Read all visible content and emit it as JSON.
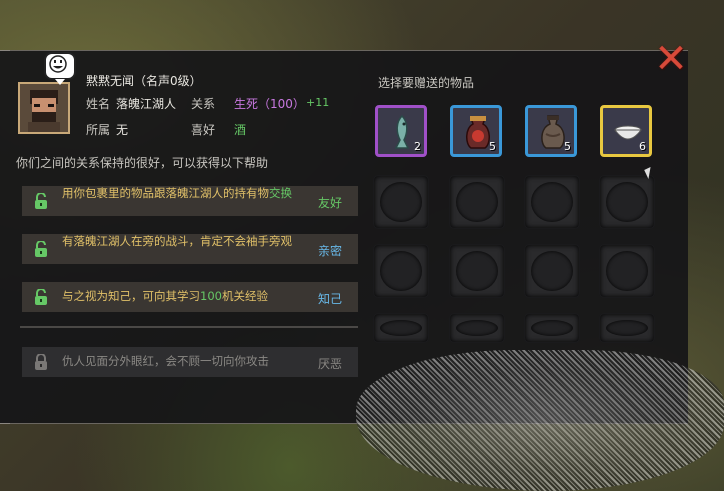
{
  "npc": {
    "name_line": "黙黙无闻（名声0级）",
    "name_label": "姓名",
    "name_value": "落魄江湖人",
    "relation_label": "关系",
    "relation_value": "生死（100）",
    "relation_bonus": "+11",
    "faction_label": "所属",
    "faction_value": "无",
    "likes_label": "喜好",
    "likes_value": "酒"
  },
  "intro": "你们之间的关系保持的很好，可以获得以下帮助",
  "help_items": [
    {
      "text_a": "用你包裹里的物品跟落魄江湖人的持有物",
      "text_b": "交换",
      "level": "友好",
      "unlocked": true
    },
    {
      "text": "有落魄江湖人在旁的战斗，肯定不会袖手旁观",
      "level": "亲密",
      "unlocked": true
    },
    {
      "text_a": "与之视为知己，可向其学习",
      "text_num": "100",
      "text_b": "机关经验",
      "level": "知己",
      "unlocked": true
    },
    {
      "text": "仇人见面分外眼红，会不顾一切向你攻击",
      "level": "厌恶",
      "unlocked": false
    }
  ],
  "gift_title": "选择要赠送的物品",
  "gift_items": [
    {
      "icon": "fish-icon",
      "count": "2",
      "rarity": "purple"
    },
    {
      "icon": "wine-jar-icon",
      "count": "5",
      "rarity": "blue"
    },
    {
      "icon": "clay-pot-icon",
      "count": "5",
      "rarity": "blue"
    },
    {
      "icon": "bowl-icon",
      "count": "6",
      "rarity": "gold"
    }
  ],
  "colors": {
    "green": "#66c866",
    "purple": "#c878e0",
    "gold_text": "#e0c068",
    "level_blue": "#68b8e8",
    "level_green": "#66c866",
    "close_red": "#d84a3a"
  }
}
